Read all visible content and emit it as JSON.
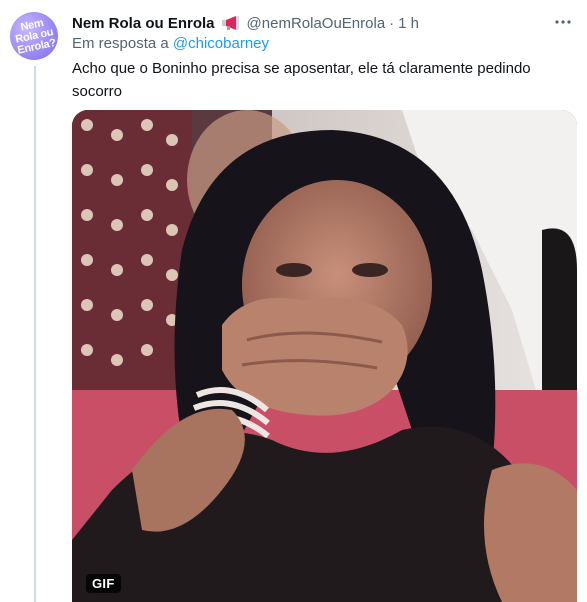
{
  "tweet": {
    "avatar_text_line1": "Nem",
    "avatar_text_line2": "Rola ou",
    "avatar_text_line3": "Enrola?",
    "display_name": "Nem Rola ou Enrola",
    "name_icon": "megaphone-icon",
    "handle": "@nemRolaOuEnrola",
    "separator": "·",
    "time": "1 h",
    "reply_prefix": "Em resposta a",
    "reply_to": "@chicobarney",
    "text": "Acho que o Boninho precisa se aposentar, ele tá claramente pedindo socorro",
    "more_icon": "more-horizontal-icon"
  },
  "media": {
    "badge": "GIF",
    "description_icon": "gif-image"
  },
  "colors": {
    "text": "#0f1419",
    "secondary": "#536471",
    "link": "#1d9bf0",
    "thread_line": "#cfd9de",
    "avatar": "#9d8cf5"
  }
}
